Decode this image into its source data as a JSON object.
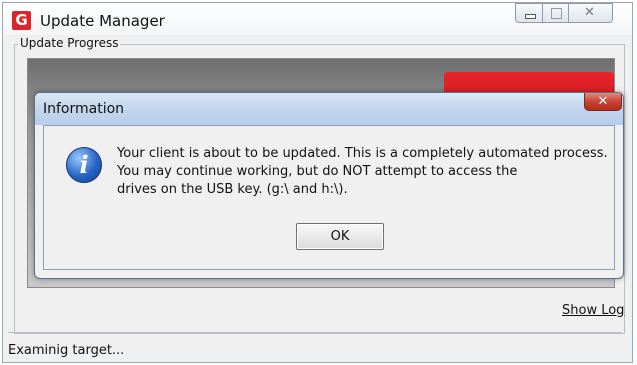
{
  "window": {
    "title": "Update Manager",
    "icon_letter": "G",
    "controls": {
      "minimize": "—",
      "maximize": "□",
      "close": "✕"
    }
  },
  "group": {
    "label": "Update Progress"
  },
  "show_log_link": "Show Log",
  "status_text": "Examinig target...",
  "dialog": {
    "title": "Information",
    "close_glyph": "✕",
    "icon": "info-icon",
    "icon_glyph": "i",
    "message_lines": [
      "Your client is about to be updated. This is a completely automated process.",
      "You may continue working, but do NOT attempt to access the",
      " drives on the USB key. (g:\\ and h:\\)."
    ],
    "ok_label": "OK"
  },
  "colors": {
    "accent_red": "#d9262b",
    "dialog_title": "#c4d7ee",
    "close_red": "#c74533"
  }
}
